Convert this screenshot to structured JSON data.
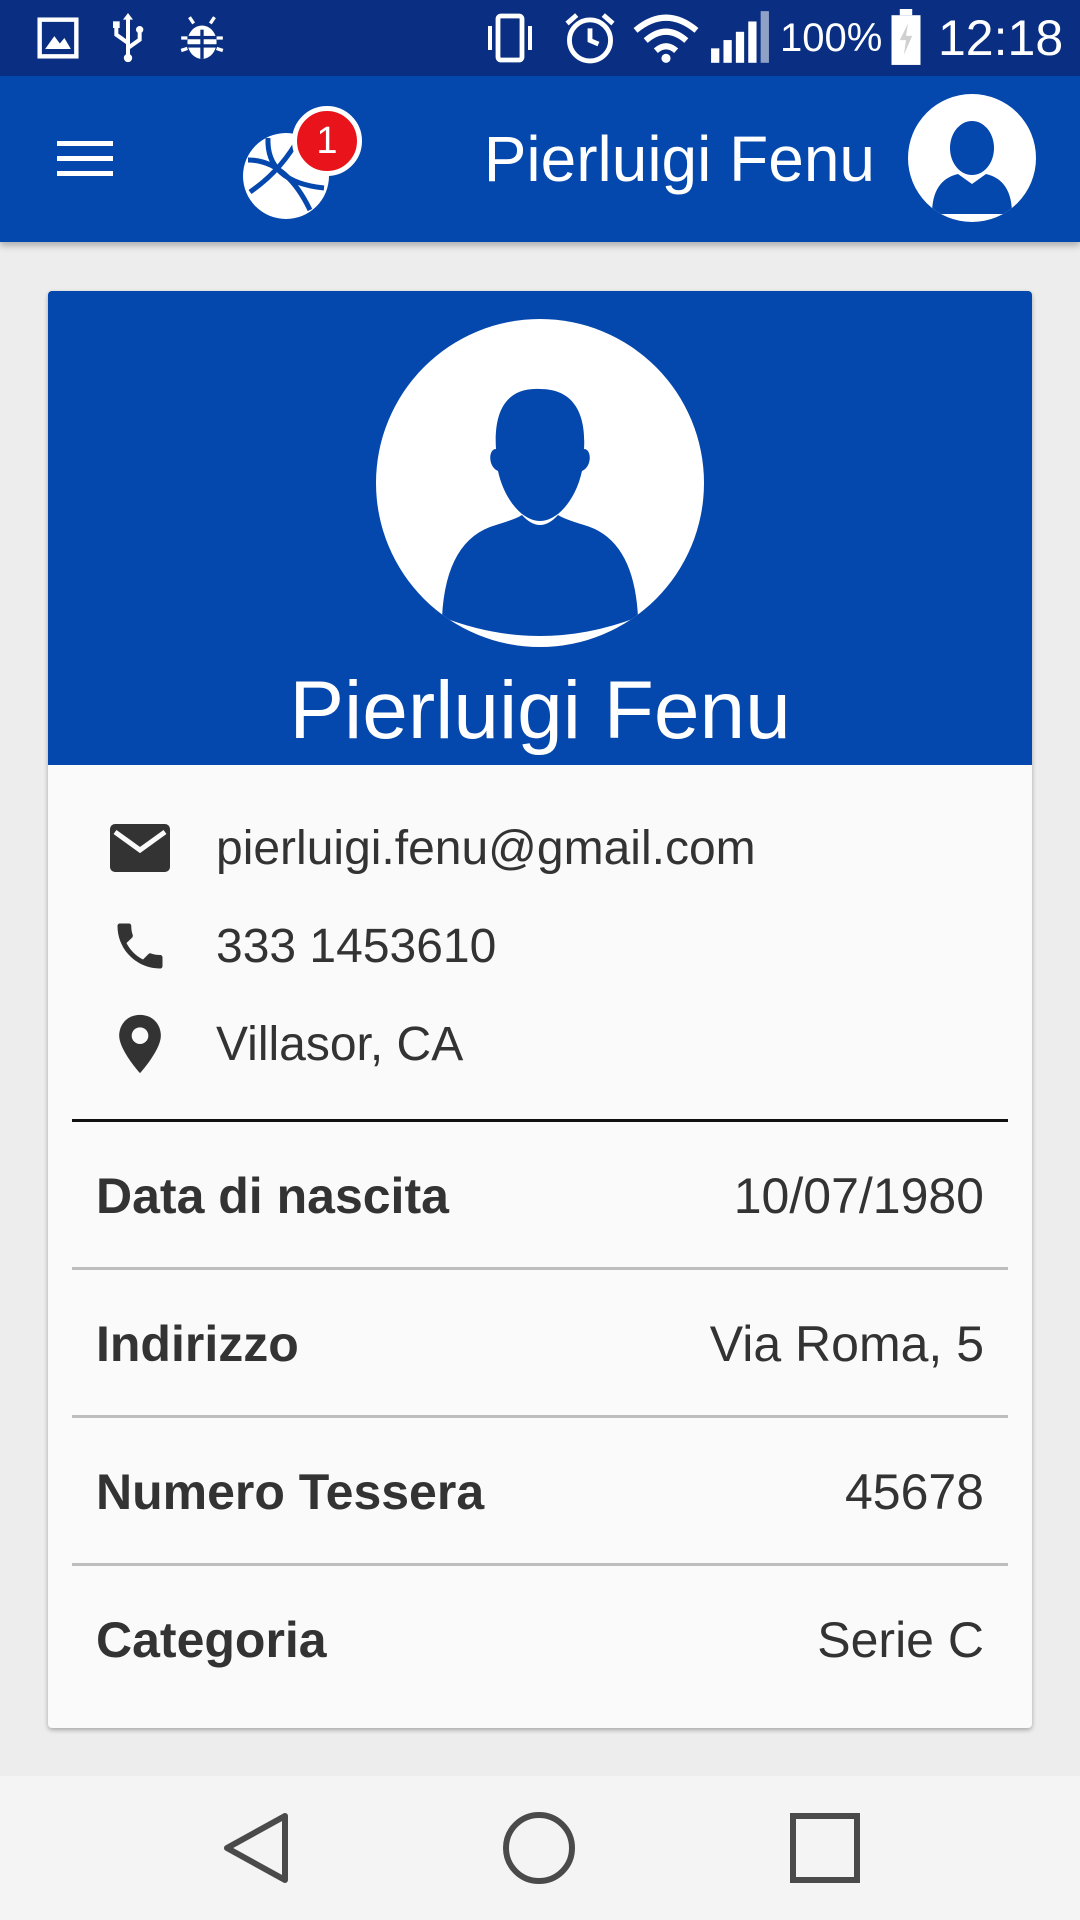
{
  "status_bar": {
    "battery_percent": "100%",
    "time": "12:18",
    "icons": [
      "gallery-icon",
      "usb-icon",
      "android-debug-icon",
      "vibrate-icon",
      "alarm-icon",
      "wifi-icon",
      "signal-icon",
      "battery-charging-icon"
    ]
  },
  "app_bar": {
    "badge_count": "1",
    "user_name": "Pierluigi Fenu",
    "icons": [
      "menu-icon",
      "basketball-icon",
      "user-avatar-icon"
    ]
  },
  "profile": {
    "name": "Pierluigi Fenu",
    "contacts": [
      {
        "icon": "email-icon",
        "text": "pierluigi.fenu@gmail.com"
      },
      {
        "icon": "phone-icon",
        "text": "333 1453610"
      },
      {
        "icon": "location-icon",
        "text": "Villasor, CA"
      }
    ],
    "details": [
      {
        "label": "Data di nascita",
        "value": "10/07/1980"
      },
      {
        "label": "Indirizzo",
        "value": "Via Roma, 5"
      },
      {
        "label": "Numero Tessera",
        "value": "45678"
      },
      {
        "label": "Categoria",
        "value": "Serie C"
      }
    ]
  },
  "nav_bar": {
    "buttons": [
      "back-icon",
      "home-icon",
      "recents-icon"
    ]
  },
  "colors": {
    "status_bar": "#0a2f82",
    "primary": "#0447ad",
    "badge": "#e8131b",
    "card_background": "#fafafa",
    "page_background": "#ededed"
  }
}
